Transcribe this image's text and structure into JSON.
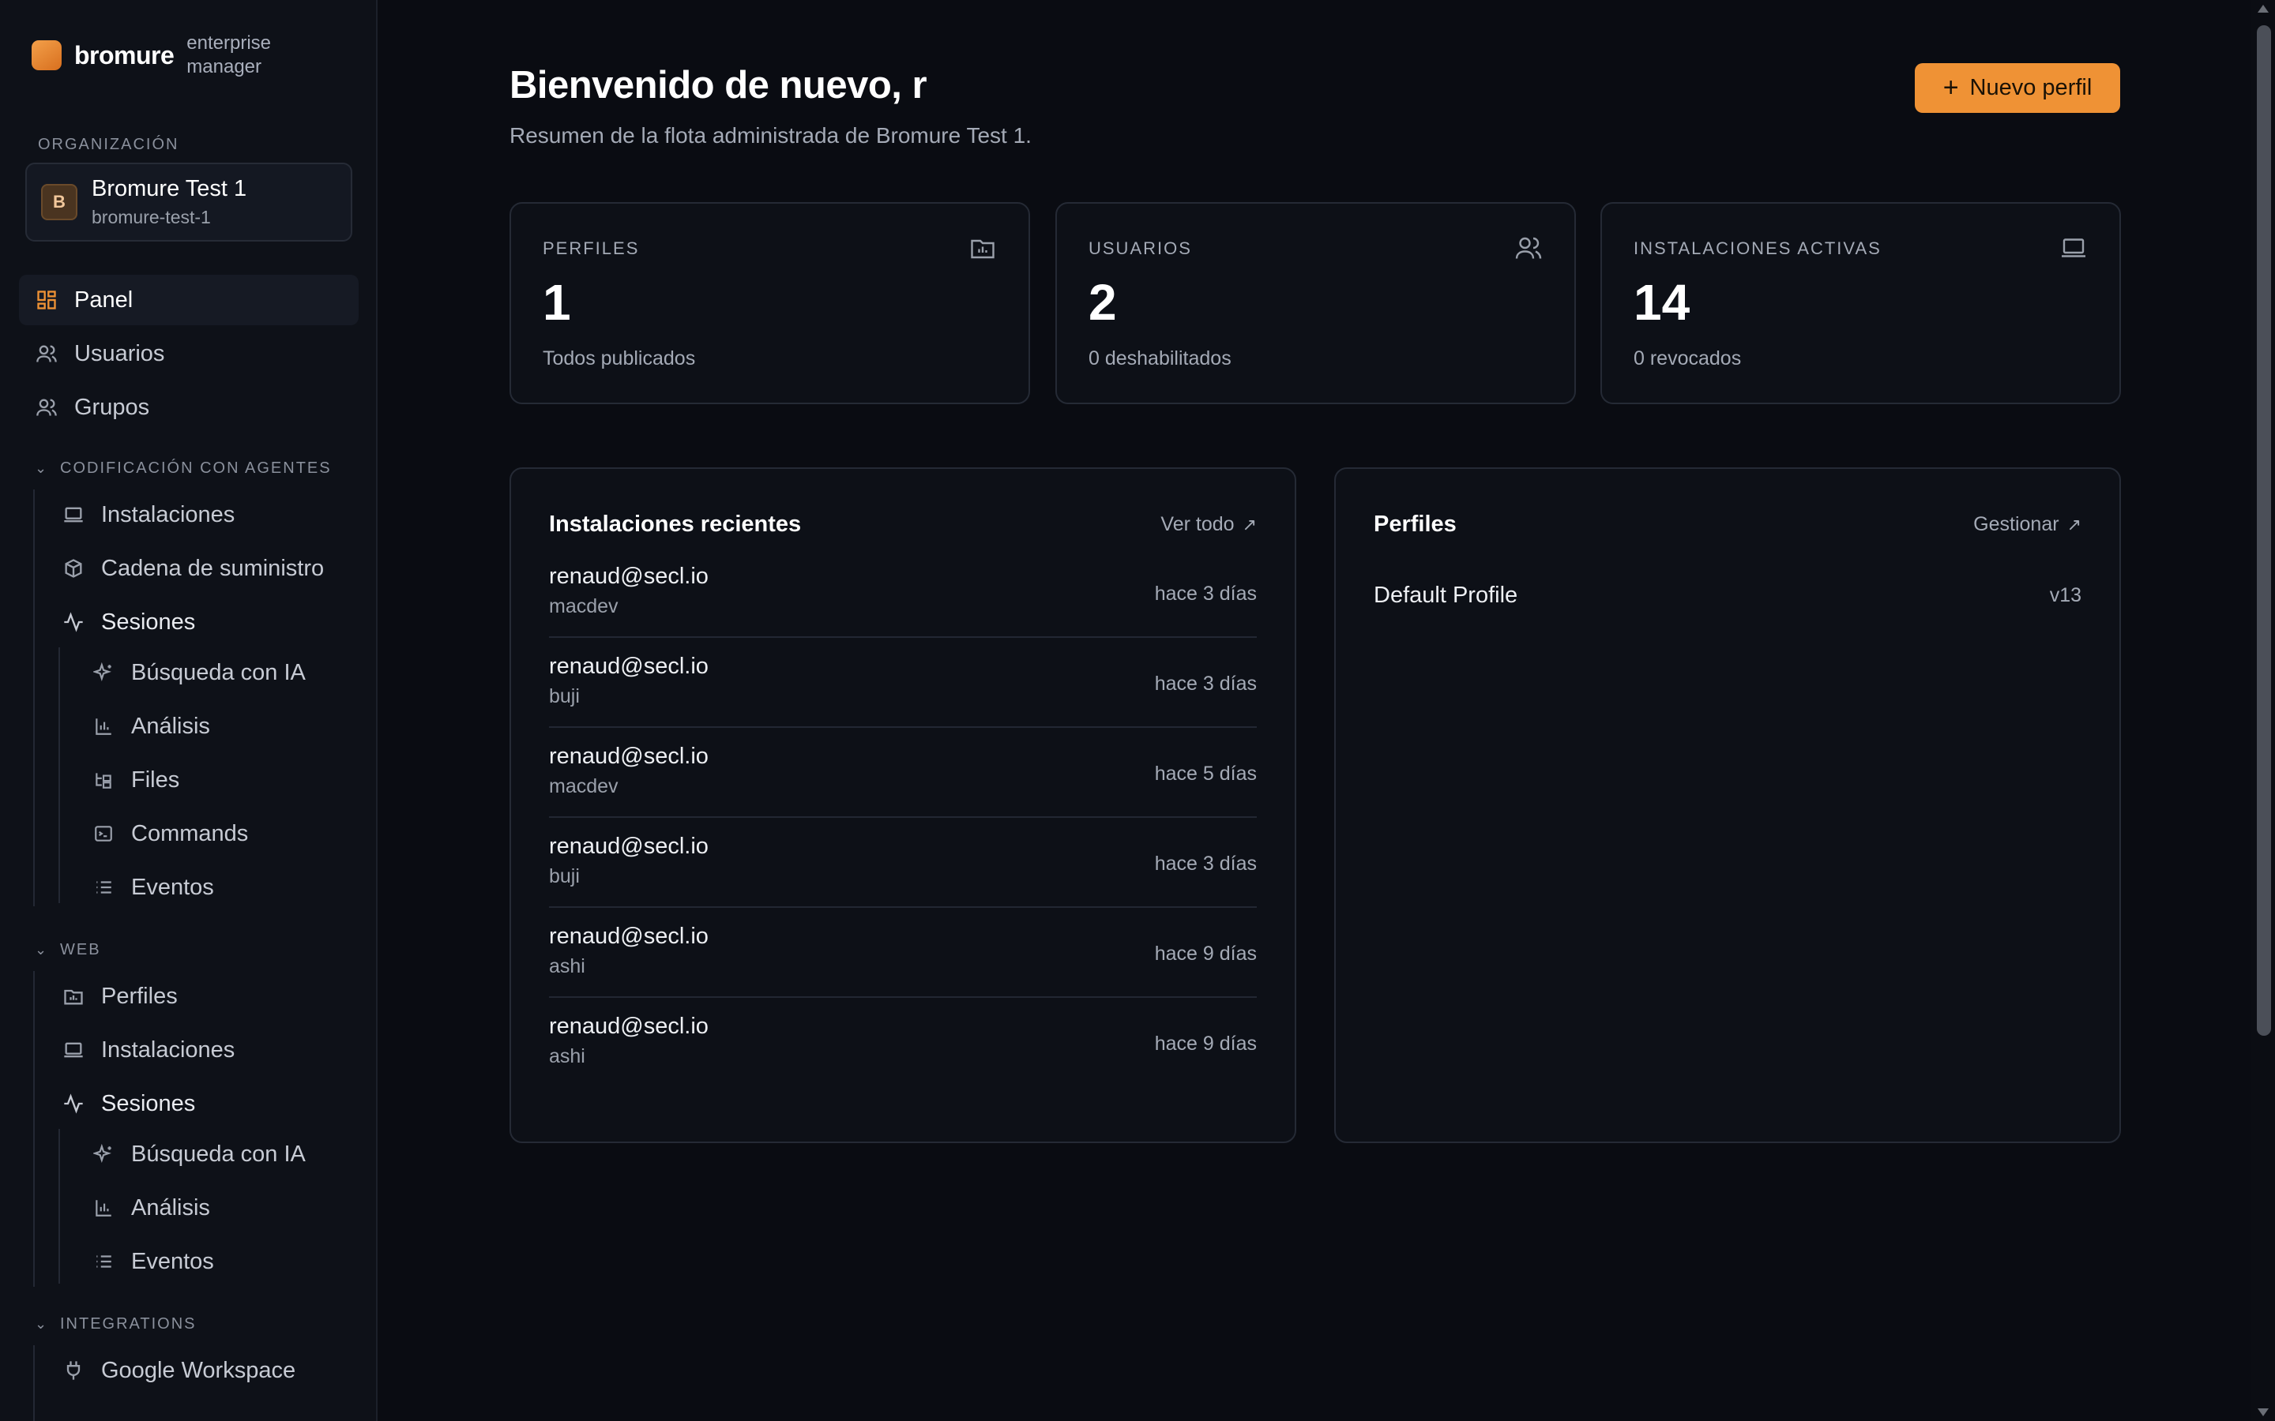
{
  "brand": {
    "name": "bromure",
    "subtitle": "enterprise manager"
  },
  "organization": {
    "section_label": "ORGANIZACIÓN",
    "avatar_letter": "B",
    "name": "Bromure Test 1",
    "slug": "bromure-test-1"
  },
  "nav": {
    "panel": "Panel",
    "users": "Usuarios",
    "groups": "Grupos"
  },
  "agentic": {
    "section_label": "CODIFICACIÓN CON AGENTES",
    "installs": "Instalaciones",
    "supply_chain": "Cadena de suministro",
    "sessions": "Sesiones",
    "ai_search": "Búsqueda con IA",
    "analytics": "Análisis",
    "files": "Files",
    "commands": "Commands",
    "events": "Eventos"
  },
  "web": {
    "section_label": "WEB",
    "profiles": "Perfiles",
    "installs": "Instalaciones",
    "sessions": "Sesiones",
    "ai_search": "Búsqueda con IA",
    "analytics": "Análisis",
    "events": "Eventos"
  },
  "integrations": {
    "section_label": "INTEGRATIONS",
    "google": "Google Workspace"
  },
  "header": {
    "title": "Bienvenido de nuevo, r",
    "subtitle": "Resumen de la flota administrada de Bromure Test 1.",
    "new_profile_button": "Nuevo perfil"
  },
  "stats": [
    {
      "label": "PERFILES",
      "value": "1",
      "note": "Todos publicados",
      "icon": "folder-chart-icon"
    },
    {
      "label": "USUARIOS",
      "value": "2",
      "note": "0 deshabilitados",
      "icon": "users-icon"
    },
    {
      "label": "INSTALACIONES ACTIVAS",
      "value": "14",
      "note": "0 revocados",
      "icon": "laptop-icon"
    }
  ],
  "recent_installs": {
    "title": "Instalaciones recientes",
    "link": "Ver todo",
    "rows": [
      {
        "email": "renaud@secl.io",
        "host": "macdev",
        "time": "hace 3 días"
      },
      {
        "email": "renaud@secl.io",
        "host": "buji",
        "time": "hace 3 días"
      },
      {
        "email": "renaud@secl.io",
        "host": "macdev",
        "time": "hace 5 días"
      },
      {
        "email": "renaud@secl.io",
        "host": "buji",
        "time": "hace 3 días"
      },
      {
        "email": "renaud@secl.io",
        "host": "ashi",
        "time": "hace 9 días"
      },
      {
        "email": "renaud@secl.io",
        "host": "ashi",
        "time": "hace 9 días"
      }
    ]
  },
  "profiles_panel": {
    "title": "Perfiles",
    "link": "Gestionar",
    "rows": [
      {
        "name": "Default Profile",
        "version": "v13"
      }
    ]
  },
  "colors": {
    "accent": "#ef9235",
    "background": "#0a0c12",
    "sidebar": "#0e1118",
    "card_border": "#252a35"
  }
}
